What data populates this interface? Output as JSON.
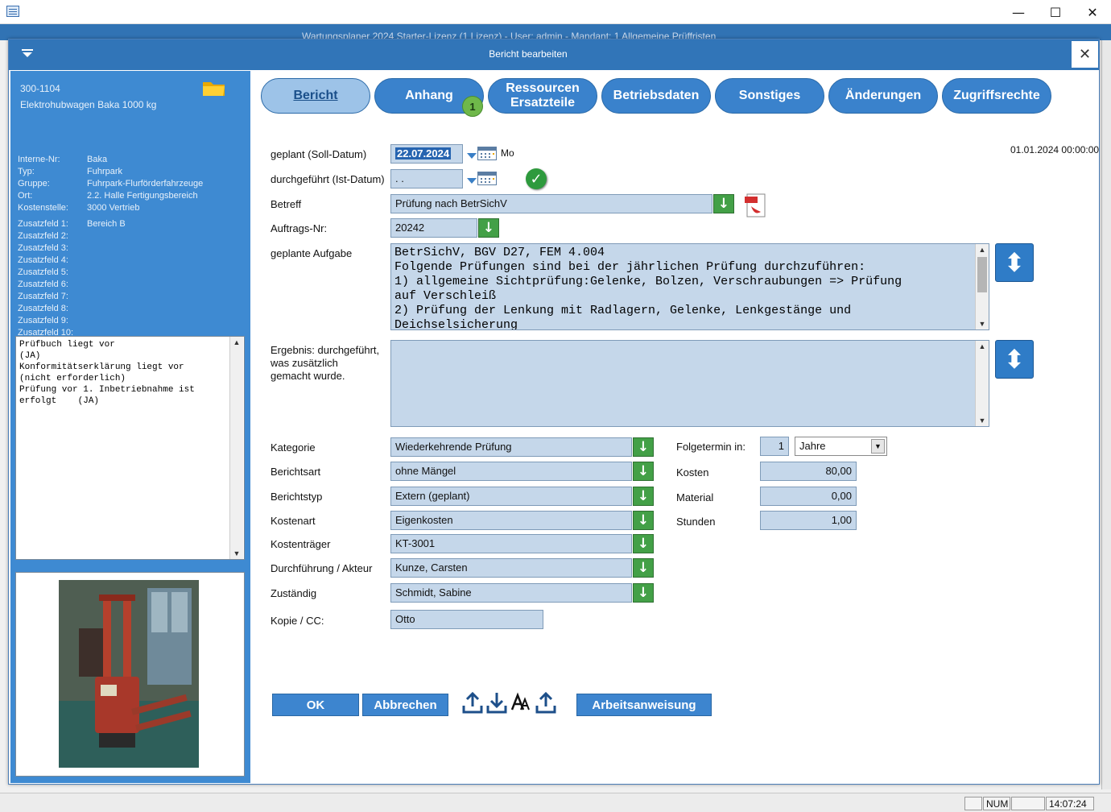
{
  "window": {
    "title": "Wartungsplaner 2024 Starter-Lizenz (1 Lizenz) - User: admin - Mandant: 1 Allgemeine Prüffristen",
    "minimize": "—",
    "maximize": "☐",
    "close": "✕"
  },
  "dialog": {
    "title": "Bericht bearbeiten",
    "close": "✕"
  },
  "asset": {
    "id": "300-1104",
    "name": "Elektrohubwagen Baka 1000 kg",
    "details": [
      {
        "key": "Interne-Nr:",
        "value": "Baka"
      },
      {
        "key": "Typ:",
        "value": "Fuhrpark"
      },
      {
        "key": "Gruppe:",
        "value": "Fuhrpark-Flurförderfahrzeuge"
      },
      {
        "key": "Ort:",
        "value": "2.2. Halle Fertigungsbereich"
      },
      {
        "key": "Kostenstelle:",
        "value": "3000 Vertrieb"
      }
    ],
    "extra_fields": [
      {
        "key": "Zusatzfeld 1:",
        "value": "Bereich B"
      },
      {
        "key": "Zusatzfeld 2:",
        "value": ""
      },
      {
        "key": "Zusatzfeld 3:",
        "value": ""
      },
      {
        "key": "Zusatzfeld 4:",
        "value": ""
      },
      {
        "key": "Zusatzfeld 5:",
        "value": ""
      },
      {
        "key": "Zusatzfeld 6:",
        "value": ""
      },
      {
        "key": "Zusatzfeld 7:",
        "value": ""
      },
      {
        "key": "Zusatzfeld 8:",
        "value": ""
      },
      {
        "key": "Zusatzfeld 9:",
        "value": ""
      },
      {
        "key": "Zusatzfeld 10:",
        "value": ""
      }
    ],
    "notes": "Prüfbuch liegt vor\n(JA)\nKonformitätserklärung liegt vor\n(nicht erforderlich)\nPrüfung vor 1. Inbetriebnahme ist\nerfolgt    (JA)"
  },
  "tabs": [
    {
      "label": "Bericht",
      "active": true
    },
    {
      "label": "Anhang",
      "active": false
    },
    {
      "label": "Ressourcen\nErsatzteile",
      "active": false
    },
    {
      "label": "Betriebsdaten",
      "active": false
    },
    {
      "label": "Sonstiges",
      "active": false
    },
    {
      "label": "Änderungen",
      "active": false
    },
    {
      "label": "Zugriffsrechte",
      "active": false
    }
  ],
  "anhang_badge": "1",
  "form": {
    "timestamp": "01.01.2024 00:00:00",
    "geplant_label": "geplant (Soll-Datum)",
    "geplant_value": "22.07.2024",
    "weekday": "Mo",
    "durchgefuehrt_label": "durchgeführt (Ist-Datum)",
    "durchgefuehrt_value": " .  .",
    "betreff_label": "Betreff",
    "betreff_value": "Prüfung nach BetrSichV",
    "auftrag_label": "Auftrags-Nr:",
    "auftrag_value": "20242",
    "aufgabe_label": "geplante Aufgabe",
    "aufgabe_value": "BetrSichV, BGV D27, FEM 4.004\nFolgende Prüfungen sind bei der jährlichen Prüfung durchzuführen:\n1) allgemeine Sichtprüfung:Gelenke, Bolzen, Verschraubungen => Prüfung\nauf Verschleiß\n2) Prüfung der Lenkung mit Radlagern, Gelenke, Lenkgestänge und\nDeichselsicherung",
    "ergebnis_label": "Ergebnis: durchgeführt,\nwas zusätzlich\ngemacht wurde.",
    "ergebnis_value": "",
    "kategorie_label": "Kategorie",
    "kategorie_value": "Wiederkehrende Prüfung",
    "berichtsart_label": "Berichtsart",
    "berichtsart_value": "ohne Mängel",
    "berichtstyp_label": "Berichtstyp",
    "berichtstyp_value": "Extern (geplant)",
    "kostenart_label": "Kostenart",
    "kostenart_value": "Eigenkosten",
    "kostentraeger_label": "Kostenträger",
    "kostentraeger_value": "KT-3001",
    "durchfuehrung_label": "Durchführung / Akteur",
    "durchfuehrung_value": "Kunze, Carsten",
    "zustaendig_label": "Zuständig",
    "zustaendig_value": "Schmidt, Sabine",
    "kopie_label": "Kopie / CC:",
    "kopie_value": "Otto",
    "folgetermin_label": "Folgetermin in:",
    "folgetermin_value": "1",
    "folgetermin_unit": "Jahre",
    "kosten_label": "Kosten",
    "kosten_value": "80,00",
    "material_label": "Material",
    "material_value": "0,00",
    "stunden_label": "Stunden",
    "stunden_value": "1,00",
    "down_arrow": "↓",
    "expand_icon": "⬍"
  },
  "buttons": {
    "ok": "OK",
    "abbrechen": "Abbrechen",
    "arbeitsanweisung": "Arbeitsanweisung"
  },
  "status": {
    "num": "NUM",
    "time": "14:07:24"
  },
  "colors": {
    "accent": "#3175b8",
    "field_bg": "#c5d7ea",
    "green": "#43a047"
  }
}
